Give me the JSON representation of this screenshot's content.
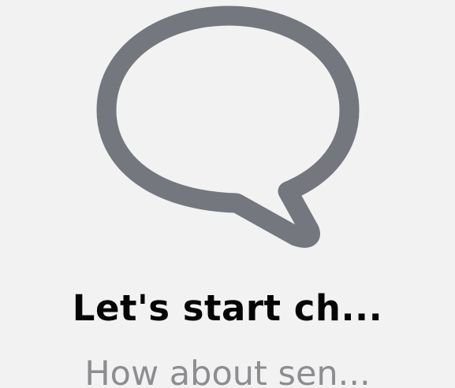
{
  "empty_state": {
    "icon": "speech-bubble-icon",
    "title": "Let's start ch...",
    "subtitle": "How about sen..."
  },
  "colors": {
    "background": "#f2f2f2",
    "icon_stroke": "#74777e",
    "title_text": "#050505",
    "subtitle_text": "#8d8d91"
  }
}
